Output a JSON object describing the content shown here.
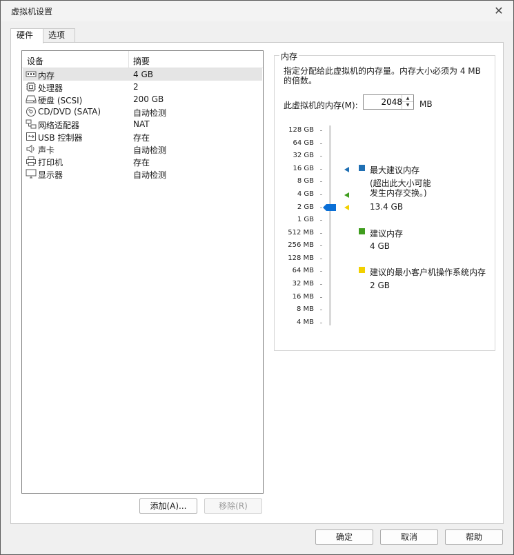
{
  "window": {
    "title": "虚拟机设置"
  },
  "tabs": [
    {
      "label": "硬件"
    },
    {
      "label": "选项"
    }
  ],
  "devices": {
    "header": {
      "device": "设备",
      "summary": "摘要"
    },
    "rows": [
      {
        "name": "内存",
        "summary": "4 GB",
        "icon": "memory-icon"
      },
      {
        "name": "处理器",
        "summary": "2",
        "icon": "processor-icon"
      },
      {
        "name": "硬盘 (SCSI)",
        "summary": "200 GB",
        "icon": "hard-disk-icon"
      },
      {
        "name": "CD/DVD (SATA)",
        "summary": "自动检测",
        "icon": "cd-dvd-icon"
      },
      {
        "name": "网络适配器",
        "summary": "NAT",
        "icon": "network-adapter-icon"
      },
      {
        "name": "USB 控制器",
        "summary": "存在",
        "icon": "usb-icon"
      },
      {
        "name": "声卡",
        "summary": "自动检测",
        "icon": "sound-card-icon"
      },
      {
        "name": "打印机",
        "summary": "存在",
        "icon": "printer-icon"
      },
      {
        "name": "显示器",
        "summary": "自动检测",
        "icon": "display-icon"
      }
    ],
    "add_label": "添加(A)...",
    "remove_label": "移除(R)"
  },
  "memory": {
    "group_title": "内存",
    "description": "指定分配给此虚拟机的内存量。内存大小必须为 4 MB 的倍数。",
    "field_label": "此虚拟机的内存(M):",
    "value": "2048",
    "unit": "MB",
    "scale": [
      "128 GB",
      "64 GB",
      "32 GB",
      "16 GB",
      "8 GB",
      "4 GB",
      "2 GB",
      "1 GB",
      "512 MB",
      "256 MB",
      "128 MB",
      "64 MB",
      "32 MB",
      "16 MB",
      "8 MB",
      "4 MB"
    ],
    "legend": {
      "max": {
        "title": "最大建议内存",
        "note": "(超出此大小可能发生内存交换。)",
        "value": "13.4 GB",
        "color": "#1f6fb3"
      },
      "recommended": {
        "title": "建议内存",
        "value": "4 GB",
        "color": "#3f9d1e"
      },
      "minimum": {
        "title": "建议的最小客户机操作系统内存",
        "value": "2 GB",
        "color": "#f2d000"
      }
    },
    "thumb_color": "#0a6fd6"
  },
  "footer": {
    "ok": "确定",
    "cancel": "取消",
    "help": "帮助"
  }
}
